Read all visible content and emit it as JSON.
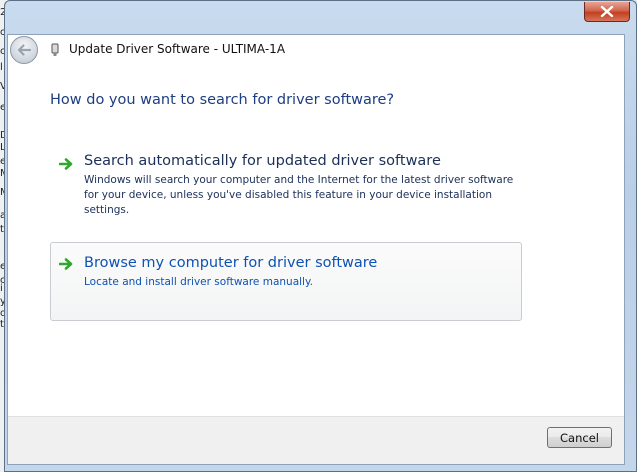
{
  "background_strip": [
    "2",
    "o",
    "c",
    "l",
    "V",
    "e",
    "D",
    "L",
    "e",
    "M",
    "M",
    "a",
    "t",
    "e",
    "c",
    "i",
    "y",
    "o",
    "t"
  ],
  "window": {
    "title": "Update Driver Software - ULTIMA-1A",
    "close_icon": "close-x-icon",
    "back_icon": "back-arrow-icon"
  },
  "main": {
    "question": "How do you want to search for driver software?",
    "options": [
      {
        "title": "Search automatically for updated driver software",
        "description": "Windows will search your computer and the Internet for the latest driver software for your device, unless you've disabled this feature in your device installation settings."
      },
      {
        "title": "Browse my computer for driver software",
        "description": "Locate and install driver software manually."
      }
    ]
  },
  "footer": {
    "cancel_label": "Cancel"
  },
  "colors": {
    "heading": "#1d3e84",
    "link_blue": "#0e52b4",
    "arrow_green": "#2fa82f"
  }
}
